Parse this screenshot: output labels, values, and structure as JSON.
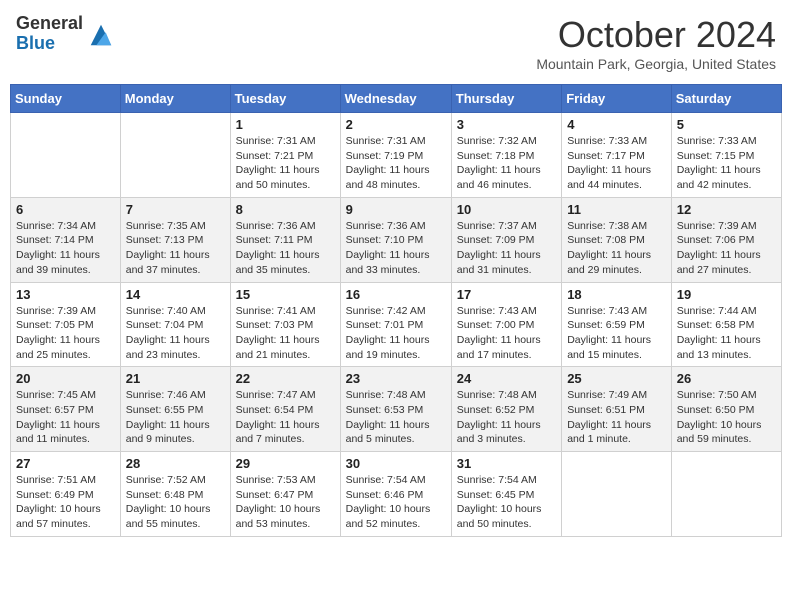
{
  "header": {
    "logo_general": "General",
    "logo_blue": "Blue",
    "title": "October 2024",
    "location": "Mountain Park, Georgia, United States"
  },
  "weekdays": [
    "Sunday",
    "Monday",
    "Tuesday",
    "Wednesday",
    "Thursday",
    "Friday",
    "Saturday"
  ],
  "weeks": [
    [
      {
        "day": "",
        "sunrise": "",
        "sunset": "",
        "daylight": ""
      },
      {
        "day": "",
        "sunrise": "",
        "sunset": "",
        "daylight": ""
      },
      {
        "day": "1",
        "sunrise": "Sunrise: 7:31 AM",
        "sunset": "Sunset: 7:21 PM",
        "daylight": "Daylight: 11 hours and 50 minutes."
      },
      {
        "day": "2",
        "sunrise": "Sunrise: 7:31 AM",
        "sunset": "Sunset: 7:19 PM",
        "daylight": "Daylight: 11 hours and 48 minutes."
      },
      {
        "day": "3",
        "sunrise": "Sunrise: 7:32 AM",
        "sunset": "Sunset: 7:18 PM",
        "daylight": "Daylight: 11 hours and 46 minutes."
      },
      {
        "day": "4",
        "sunrise": "Sunrise: 7:33 AM",
        "sunset": "Sunset: 7:17 PM",
        "daylight": "Daylight: 11 hours and 44 minutes."
      },
      {
        "day": "5",
        "sunrise": "Sunrise: 7:33 AM",
        "sunset": "Sunset: 7:15 PM",
        "daylight": "Daylight: 11 hours and 42 minutes."
      }
    ],
    [
      {
        "day": "6",
        "sunrise": "Sunrise: 7:34 AM",
        "sunset": "Sunset: 7:14 PM",
        "daylight": "Daylight: 11 hours and 39 minutes."
      },
      {
        "day": "7",
        "sunrise": "Sunrise: 7:35 AM",
        "sunset": "Sunset: 7:13 PM",
        "daylight": "Daylight: 11 hours and 37 minutes."
      },
      {
        "day": "8",
        "sunrise": "Sunrise: 7:36 AM",
        "sunset": "Sunset: 7:11 PM",
        "daylight": "Daylight: 11 hours and 35 minutes."
      },
      {
        "day": "9",
        "sunrise": "Sunrise: 7:36 AM",
        "sunset": "Sunset: 7:10 PM",
        "daylight": "Daylight: 11 hours and 33 minutes."
      },
      {
        "day": "10",
        "sunrise": "Sunrise: 7:37 AM",
        "sunset": "Sunset: 7:09 PM",
        "daylight": "Daylight: 11 hours and 31 minutes."
      },
      {
        "day": "11",
        "sunrise": "Sunrise: 7:38 AM",
        "sunset": "Sunset: 7:08 PM",
        "daylight": "Daylight: 11 hours and 29 minutes."
      },
      {
        "day": "12",
        "sunrise": "Sunrise: 7:39 AM",
        "sunset": "Sunset: 7:06 PM",
        "daylight": "Daylight: 11 hours and 27 minutes."
      }
    ],
    [
      {
        "day": "13",
        "sunrise": "Sunrise: 7:39 AM",
        "sunset": "Sunset: 7:05 PM",
        "daylight": "Daylight: 11 hours and 25 minutes."
      },
      {
        "day": "14",
        "sunrise": "Sunrise: 7:40 AM",
        "sunset": "Sunset: 7:04 PM",
        "daylight": "Daylight: 11 hours and 23 minutes."
      },
      {
        "day": "15",
        "sunrise": "Sunrise: 7:41 AM",
        "sunset": "Sunset: 7:03 PM",
        "daylight": "Daylight: 11 hours and 21 minutes."
      },
      {
        "day": "16",
        "sunrise": "Sunrise: 7:42 AM",
        "sunset": "Sunset: 7:01 PM",
        "daylight": "Daylight: 11 hours and 19 minutes."
      },
      {
        "day": "17",
        "sunrise": "Sunrise: 7:43 AM",
        "sunset": "Sunset: 7:00 PM",
        "daylight": "Daylight: 11 hours and 17 minutes."
      },
      {
        "day": "18",
        "sunrise": "Sunrise: 7:43 AM",
        "sunset": "Sunset: 6:59 PM",
        "daylight": "Daylight: 11 hours and 15 minutes."
      },
      {
        "day": "19",
        "sunrise": "Sunrise: 7:44 AM",
        "sunset": "Sunset: 6:58 PM",
        "daylight": "Daylight: 11 hours and 13 minutes."
      }
    ],
    [
      {
        "day": "20",
        "sunrise": "Sunrise: 7:45 AM",
        "sunset": "Sunset: 6:57 PM",
        "daylight": "Daylight: 11 hours and 11 minutes."
      },
      {
        "day": "21",
        "sunrise": "Sunrise: 7:46 AM",
        "sunset": "Sunset: 6:55 PM",
        "daylight": "Daylight: 11 hours and 9 minutes."
      },
      {
        "day": "22",
        "sunrise": "Sunrise: 7:47 AM",
        "sunset": "Sunset: 6:54 PM",
        "daylight": "Daylight: 11 hours and 7 minutes."
      },
      {
        "day": "23",
        "sunrise": "Sunrise: 7:48 AM",
        "sunset": "Sunset: 6:53 PM",
        "daylight": "Daylight: 11 hours and 5 minutes."
      },
      {
        "day": "24",
        "sunrise": "Sunrise: 7:48 AM",
        "sunset": "Sunset: 6:52 PM",
        "daylight": "Daylight: 11 hours and 3 minutes."
      },
      {
        "day": "25",
        "sunrise": "Sunrise: 7:49 AM",
        "sunset": "Sunset: 6:51 PM",
        "daylight": "Daylight: 11 hours and 1 minute."
      },
      {
        "day": "26",
        "sunrise": "Sunrise: 7:50 AM",
        "sunset": "Sunset: 6:50 PM",
        "daylight": "Daylight: 10 hours and 59 minutes."
      }
    ],
    [
      {
        "day": "27",
        "sunrise": "Sunrise: 7:51 AM",
        "sunset": "Sunset: 6:49 PM",
        "daylight": "Daylight: 10 hours and 57 minutes."
      },
      {
        "day": "28",
        "sunrise": "Sunrise: 7:52 AM",
        "sunset": "Sunset: 6:48 PM",
        "daylight": "Daylight: 10 hours and 55 minutes."
      },
      {
        "day": "29",
        "sunrise": "Sunrise: 7:53 AM",
        "sunset": "Sunset: 6:47 PM",
        "daylight": "Daylight: 10 hours and 53 minutes."
      },
      {
        "day": "30",
        "sunrise": "Sunrise: 7:54 AM",
        "sunset": "Sunset: 6:46 PM",
        "daylight": "Daylight: 10 hours and 52 minutes."
      },
      {
        "day": "31",
        "sunrise": "Sunrise: 7:54 AM",
        "sunset": "Sunset: 6:45 PM",
        "daylight": "Daylight: 10 hours and 50 minutes."
      },
      {
        "day": "",
        "sunrise": "",
        "sunset": "",
        "daylight": ""
      },
      {
        "day": "",
        "sunrise": "",
        "sunset": "",
        "daylight": ""
      }
    ]
  ]
}
